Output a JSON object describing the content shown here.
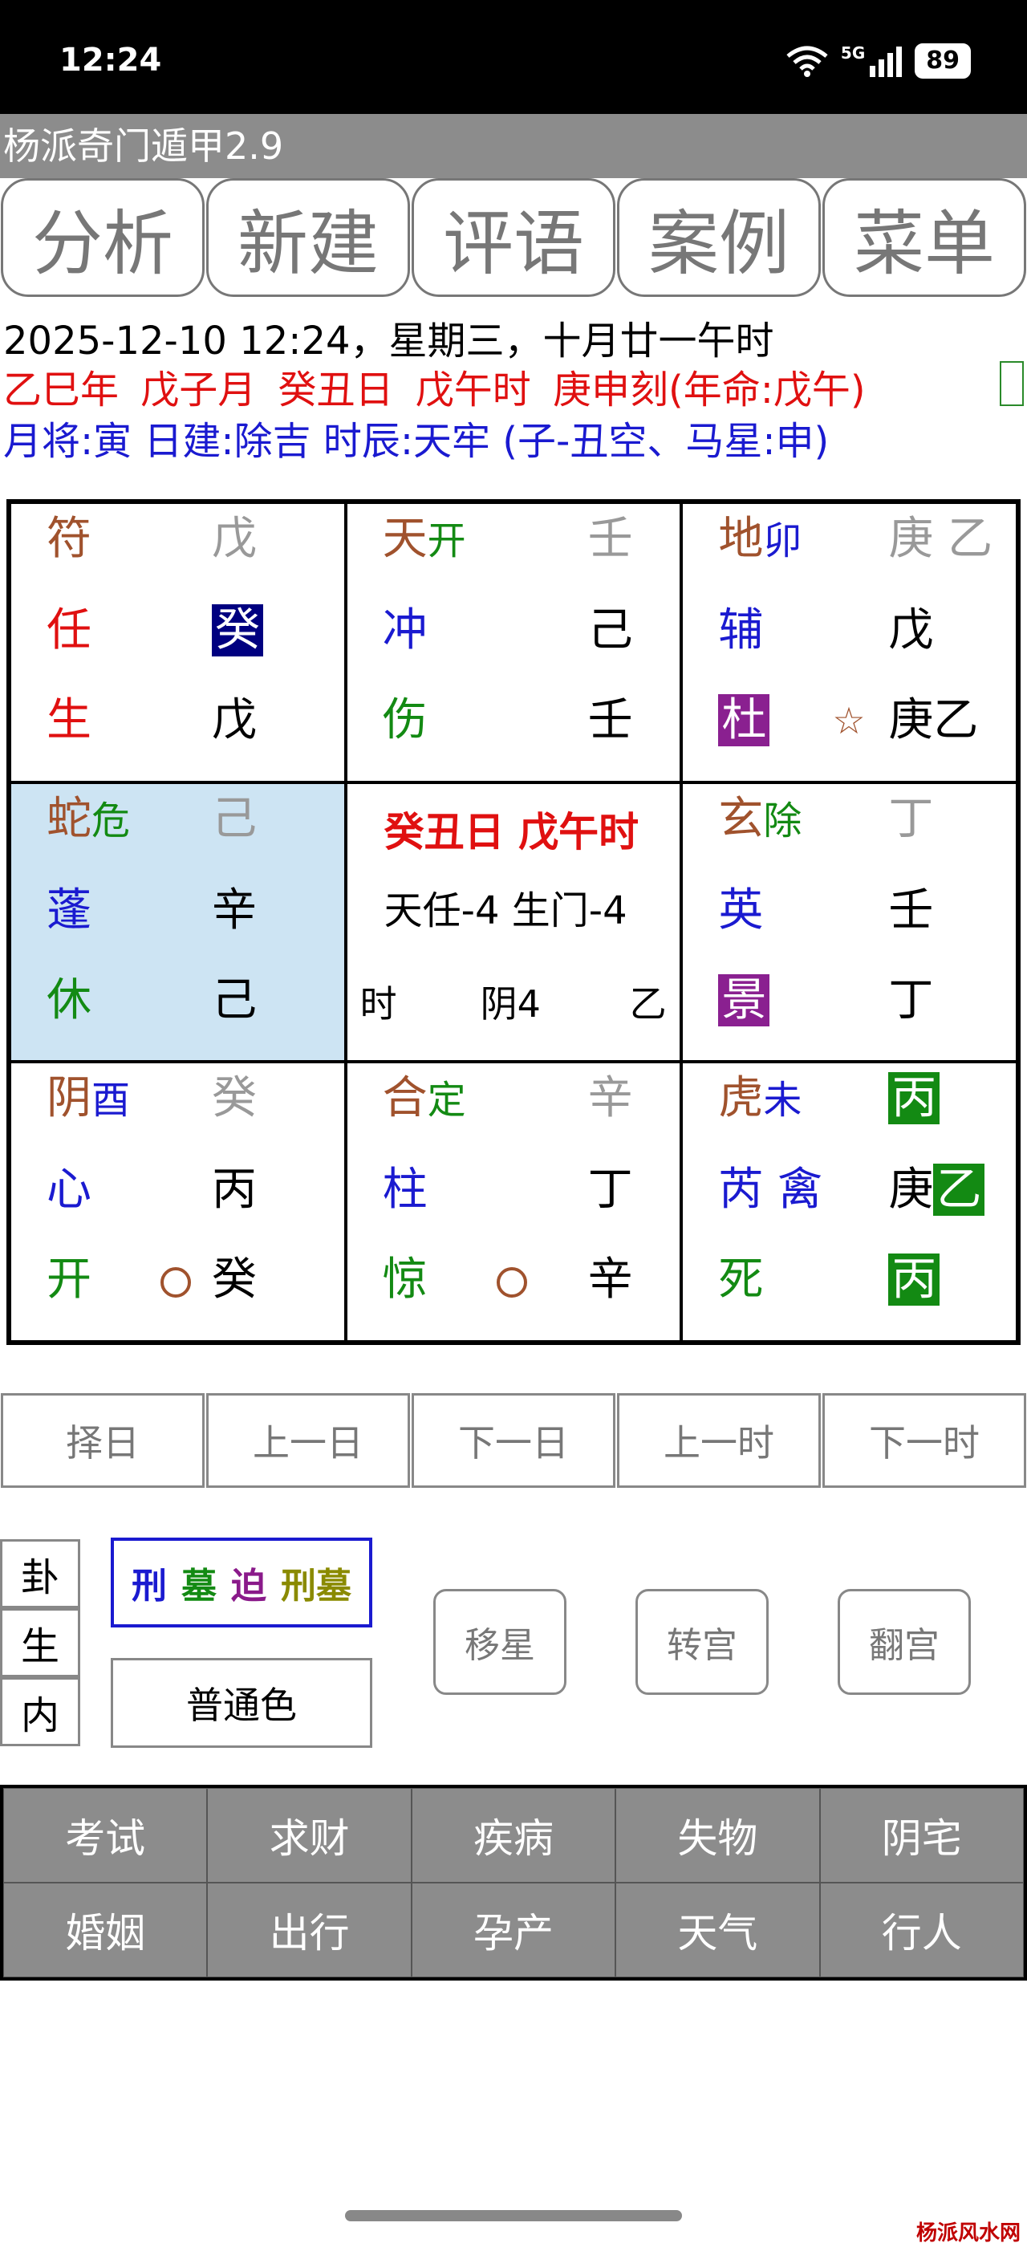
{
  "status_bar": {
    "time": "12:24",
    "network": "5G",
    "battery": "89"
  },
  "app": {
    "title": "杨派奇门遁甲2.9"
  },
  "top_nav": [
    "分析",
    "新建",
    "评语",
    "案例",
    "菜单"
  ],
  "info": {
    "line1": "2025-12-10 12:24，星期三，十月廿一午时",
    "line2": "乙巳年 戊子月 癸丑日 戊午时 庚申刻(年命:戊午)",
    "line3": "月将:寅 日建:除吉 时辰:天牢 (子-丑空、马星:申)"
  },
  "palaces": [
    {
      "god": "符",
      "god_tag": "",
      "top_stem": "戊",
      "top_stem2": "",
      "star": "任",
      "star2": "",
      "mid_stem": "癸",
      "mid_stem2": "",
      "door": "生",
      "bot_stem": "戊",
      "bot_stem2": ""
    },
    {
      "god": "天",
      "god_tag": "开",
      "top_stem": "壬",
      "top_stem2": "",
      "star": "冲",
      "star2": "",
      "mid_stem": "己",
      "mid_stem2": "",
      "door": "伤",
      "bot_stem": "壬",
      "bot_stem2": ""
    },
    {
      "god": "地",
      "god_tag": "卯",
      "top_stem": "庚",
      "top_stem2": "乙",
      "star": "辅",
      "star2": "",
      "mid_stem": "戊",
      "mid_stem2": "",
      "door": "杜",
      "bot_stem": "庚",
      "bot_stem2": "乙"
    },
    {
      "god": "蛇",
      "god_tag": "危",
      "top_stem": "己",
      "top_stem2": "",
      "star": "蓬",
      "star2": "",
      "mid_stem": "辛",
      "mid_stem2": "",
      "door": "休",
      "bot_stem": "己",
      "bot_stem2": ""
    },
    {
      "center_title": "癸丑日 戊午时",
      "center_line": "天任-4 生门-4",
      "center_left": "时",
      "center_mid": "阴4",
      "center_right": "乙"
    },
    {
      "god": "玄",
      "god_tag": "除",
      "top_stem": "丁",
      "top_stem2": "",
      "star": "英",
      "star2": "",
      "mid_stem": "壬",
      "mid_stem2": "",
      "door": "景",
      "bot_stem": "丁",
      "bot_stem2": ""
    },
    {
      "god": "阴",
      "god_tag": "酉",
      "top_stem": "癸",
      "top_stem2": "",
      "star": "心",
      "star2": "",
      "mid_stem": "丙",
      "mid_stem2": "",
      "door": "开",
      "bot_stem": "癸",
      "bot_stem2": ""
    },
    {
      "god": "合",
      "god_tag": "定",
      "top_stem": "辛",
      "top_stem2": "",
      "star": "柱",
      "star2": "",
      "mid_stem": "丁",
      "mid_stem2": "",
      "door": "惊",
      "bot_stem": "辛",
      "bot_stem2": ""
    },
    {
      "god": "虎",
      "god_tag": "未",
      "top_stem": "丙",
      "top_stem2": "",
      "star": "芮",
      "star2": "禽",
      "mid_stem": "庚",
      "mid_stem2": "乙",
      "door": "死",
      "bot_stem": "丙",
      "bot_stem2": ""
    }
  ],
  "marks": {
    "star_mark": "☆"
  },
  "time_nav": [
    "择日",
    "上一日",
    "下一日",
    "上一时",
    "下一时"
  ],
  "side_tabs": [
    "卦",
    "生",
    "内"
  ],
  "legend": [
    "刑",
    "墓",
    "迫",
    "刑墓"
  ],
  "color_mode": "普通色",
  "actions": [
    "移星",
    "转宫",
    "翻宫"
  ],
  "categories": [
    [
      "考试",
      "求财",
      "疾病",
      "失物",
      "阴宅"
    ],
    [
      "婚姻",
      "出行",
      "孕产",
      "天气",
      "行人"
    ]
  ],
  "watermark": "杨派风水网"
}
